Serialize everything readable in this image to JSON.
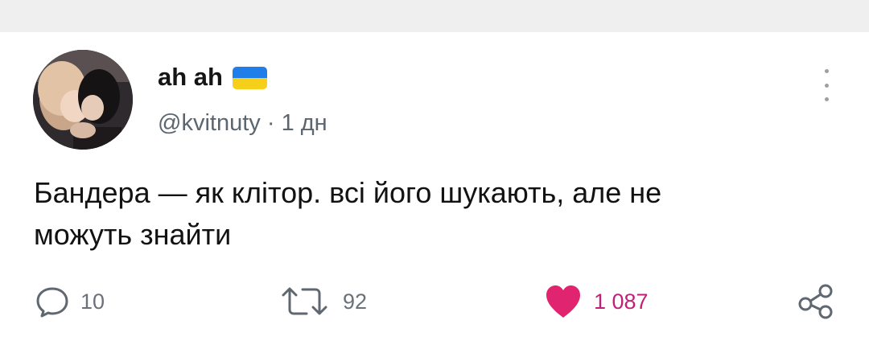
{
  "tweet": {
    "display_name": "ah ah",
    "handle": "@kvitnuty",
    "separator": "·",
    "time": "1 дн",
    "text_line1": "Бандера — як клітор. всі його шукають, але не",
    "text_line2": "можуть знайти",
    "flag": {
      "icon": "ukraine-flag-icon",
      "top_color": "#1f7ee8",
      "bottom_color": "#f5cf1a"
    }
  },
  "actions": {
    "reply_count": "10",
    "retweet_count": "92",
    "like_count": "1 087",
    "icons": [
      "reply-icon",
      "retweet-icon",
      "heart-icon",
      "share-icon"
    ],
    "like_color": "#e0246f"
  },
  "menu": {
    "icon": "more-vertical-icon"
  }
}
